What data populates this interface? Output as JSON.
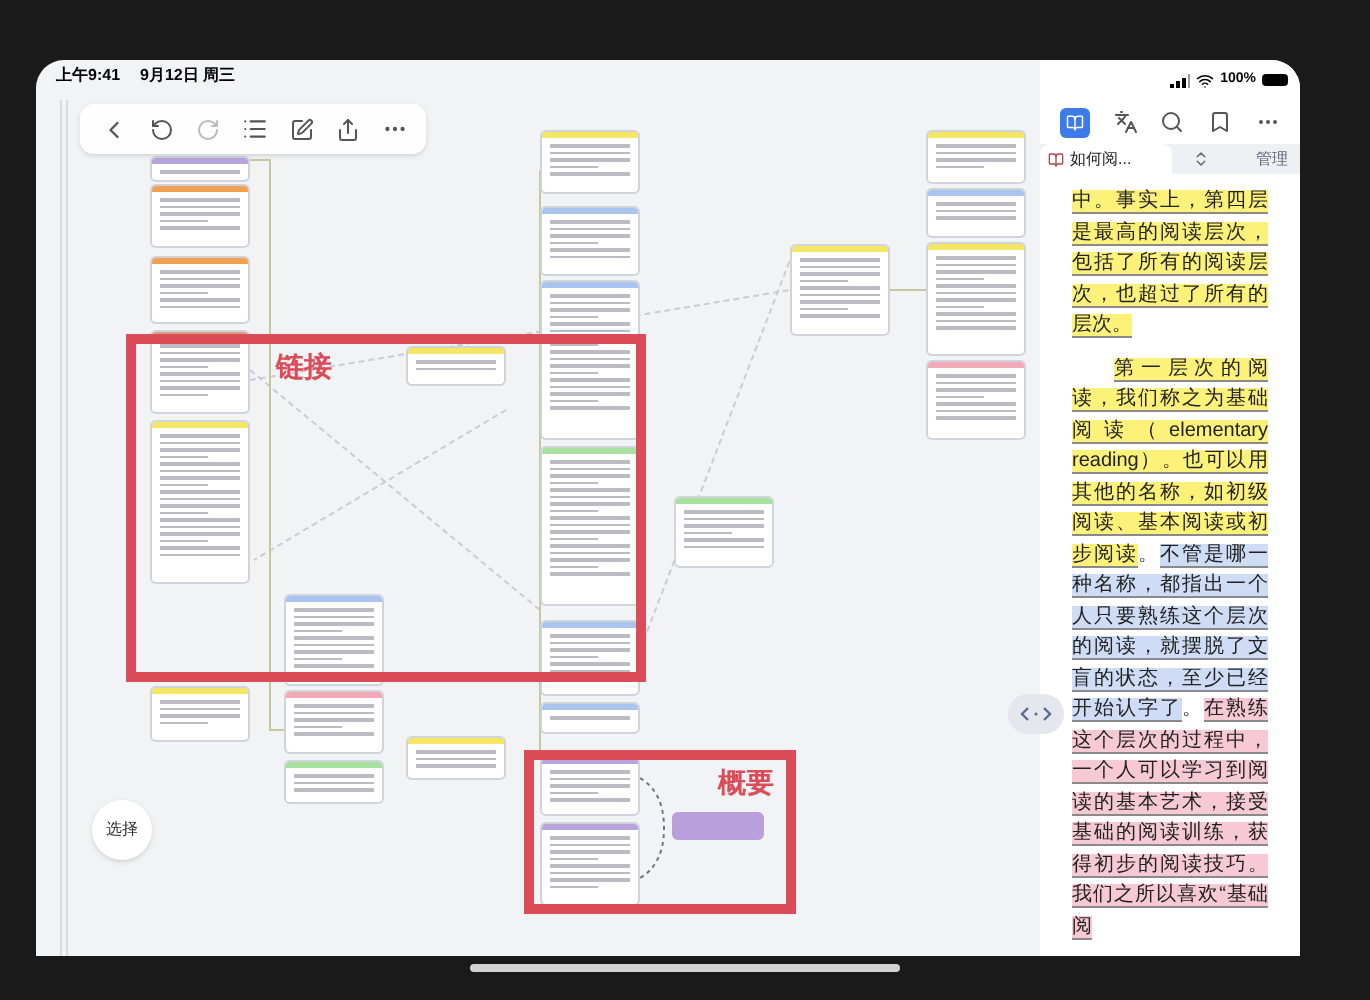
{
  "status_bar": {
    "time": "上午9:41",
    "date": "9月12日 周三",
    "battery": "100%"
  },
  "mindmap": {
    "nodes": [
      {
        "color": "#b9a3dd"
      },
      {
        "color": "#f0a050"
      },
      {
        "color": "#f0a050"
      },
      {
        "color": "#d9a080"
      },
      {
        "color": "#f5e663"
      },
      {
        "color": "#f5e663"
      },
      {
        "color": "#a9c4ee"
      },
      {
        "color": "#f2a9b8"
      },
      {
        "color": "#a8e0a0"
      },
      {
        "color": "#f5e663"
      },
      {
        "color": "#f5e663"
      },
      {
        "color": "#f5e663"
      },
      {
        "color": "#a9c4ee"
      },
      {
        "color": "#a9c4ee"
      },
      {
        "color": "#a8e0a0"
      },
      {
        "color": "#a9c4ee"
      },
      {
        "color": "#a9c4ee"
      },
      {
        "color": "#b9a3dd"
      },
      {
        "color": "#b9a3dd"
      },
      {
        "color": "#a8e0a0"
      },
      {
        "color": "#f5e663"
      },
      {
        "color": "#f5e663"
      },
      {
        "color": "#a9c4ee"
      },
      {
        "color": "#f5e663"
      },
      {
        "color": "#f2a9b8"
      }
    ],
    "annotations": [
      {
        "label": "链接"
      },
      {
        "label": "概要"
      }
    ],
    "select_button": "选择"
  },
  "reader": {
    "tab": "如何阅...",
    "manage": "管理",
    "paragraphs": [
      {
        "indent": false,
        "segments": [
          {
            "text": "中。事实上，第四层是最高的阅读层次，包括了所有的阅读层次，也超过了所有的层次。",
            "color": "#fcf27a"
          }
        ]
      },
      {
        "indent": true,
        "segments": [
          {
            "text": "第一层次的阅读，我们称之为基础阅读（elementary reading）。也可以用其他的名称，如初级阅读、基本阅读或初步阅读",
            "color": "#fcf27a"
          },
          {
            "text": "。"
          },
          {
            "text": "不管是哪一种名称，都指出一个人只要熟练这个层次的阅读，就摆脱了文盲的状态，至少已经开始认字了",
            "color": "#cfdcf5"
          },
          {
            "text": "。"
          },
          {
            "text": "在熟练这个层次的过程中，一个人可以学习到阅读的基本艺术，接受基础的阅读训练，获得初步的阅读技巧。我们之所以喜欢“基础阅",
            "color": "#f6c9d4"
          }
        ]
      }
    ]
  }
}
